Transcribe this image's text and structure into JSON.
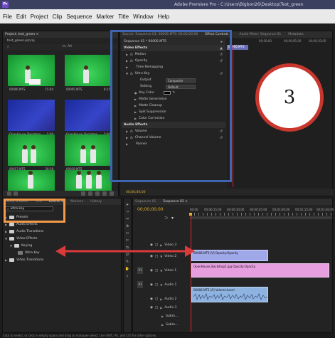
{
  "window": {
    "app_icon": "Pr",
    "title": "Adobe Premiere Pro - C:\\Users\\Bigbon26\\Desktop\\Test_green"
  },
  "menu": [
    "File",
    "Edit",
    "Project",
    "Clip",
    "Sequence",
    "Marker",
    "Title",
    "Window",
    "Help"
  ],
  "project_panel": {
    "tab": "Project: test_green ×",
    "file_label": "test_green.prproj",
    "count": "In: All",
    "thumbnails": [
      {
        "name": "00006.MTS",
        "duration": "15:04",
        "kind": "green"
      },
      {
        "name": "00005.MTS",
        "duration": "8:15",
        "kind": "green"
      },
      {
        "name": "OpenHouse_Backdrop...",
        "duration": "5;00",
        "kind": "blue"
      },
      {
        "name": "OpenHouse_Backdrop...",
        "duration": "5;00",
        "kind": "blue"
      },
      {
        "name": "00017.MTS",
        "duration": "20:18",
        "kind": "green"
      },
      {
        "name": "00019.MTS",
        "duration": "",
        "kind": "green"
      },
      {
        "name": "",
        "duration": "",
        "kind": "green"
      },
      {
        "name": "",
        "duration": "",
        "kind": "green"
      }
    ]
  },
  "effect_controls": {
    "tabs": [
      "Source: Sequence 01: 00006.MTS: 00;00;00;00",
      "Effect Controls ×",
      "Audio Mixer: Sequence 01",
      "Metadata"
    ],
    "clip_label": "Sequence 01 * 00006.MTS",
    "clip_tag": "00006.MTS",
    "video_effects_header": "Video Effects",
    "rows": [
      {
        "label": "Motion",
        "level": 1
      },
      {
        "label": "Opacity",
        "level": 1
      },
      {
        "label": "Time Remapping",
        "level": 1
      },
      {
        "label": "Ultra Key",
        "level": 1
      }
    ],
    "ultra_key": {
      "output_label": "Output",
      "output_value": "Composite",
      "setting_label": "Setting",
      "setting_value": "Default",
      "key_color_label": "Key Color",
      "sub": [
        "Matte Generation",
        "Matte Cleanup",
        "Spill Suppression",
        "Color Correction"
      ]
    },
    "audio_effects_header": "Audio Effects",
    "audio_rows": [
      "Volume",
      "Channel Volume",
      "Panner"
    ],
    "timecode": "00;00;00;00"
  },
  "program_monitor": {
    "ruler_times": [
      "00;00;00",
      "00;00;05;00",
      "00;00;10;00"
    ]
  },
  "annotation": {
    "number": "3"
  },
  "effects_panel": {
    "tabs": [
      "Media Browser",
      "Info",
      "Effects ×",
      "Markers",
      "History"
    ],
    "search_value": "ultra key",
    "items": [
      {
        "label": "Presets",
        "indent": 0
      },
      {
        "label": "Audio Effects",
        "indent": 0
      },
      {
        "label": "Audio Transitions",
        "indent": 0
      },
      {
        "label": "Video Effects",
        "indent": 0
      },
      {
        "label": "Keying",
        "indent": 1
      },
      {
        "label": "Ultra Key",
        "indent": 2
      },
      {
        "label": "Video Transitions",
        "indent": 0
      }
    ]
  },
  "timeline": {
    "tabs": [
      "Sequence 01",
      "Sequence 02 ×"
    ],
    "timecode": "00;00;00;00",
    "ruler_times": [
      "00;00",
      "00;00;15;00",
      "00;00;30;00",
      "00;00;45;00",
      "00;01;00;00",
      "00;01;15;00",
      "00;01;30;00"
    ],
    "video_tracks": [
      "Video 3",
      "Video 2",
      "Video 1"
    ],
    "audio_tracks": [
      "Audio 1",
      "Audio 2",
      "Audio 3",
      "Subm...",
      "Subm..."
    ],
    "track_labels": {
      "a1": "A1",
      "v1": "V1"
    },
    "clips": {
      "v2": "00006.MTS [V]  Opacity:Opacity",
      "v1": "OpenHouse_Backdrop2.jpg  Opacity:Opacity",
      "a1": "00006.MTS [A]  Volume:Level"
    }
  },
  "status_bar": "Click to select, or click in empty space and drag to marquee select. Use Shift, Alt, and Ctrl for other options.",
  "colors": {
    "annotation_box_blue": "#3f64b0",
    "annotation_box_orange": "#f29a4a",
    "annotation_arrow": "#d93a3a",
    "annotation_circle_red": "#c8372d"
  }
}
